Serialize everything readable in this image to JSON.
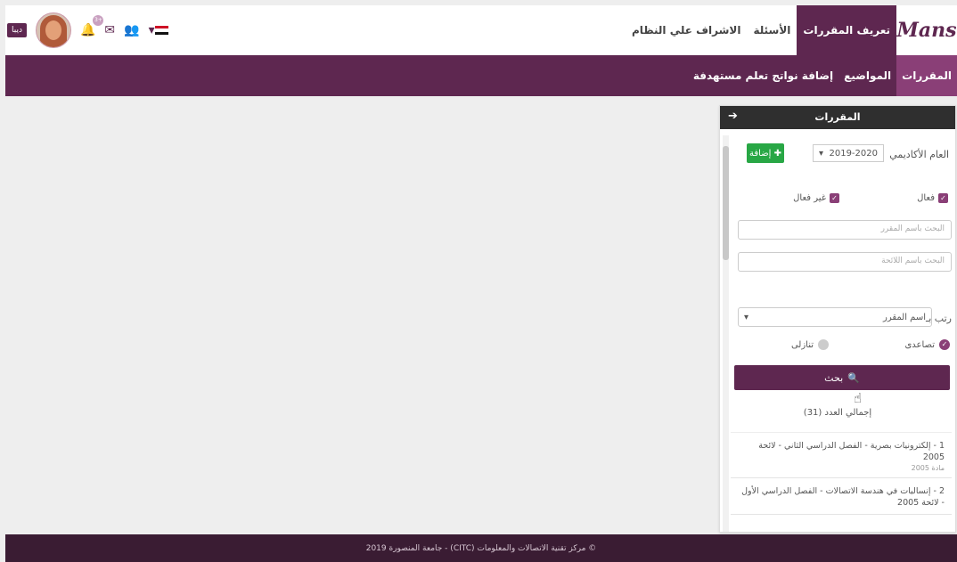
{
  "header": {
    "brand": "Mans",
    "nav": [
      {
        "label": "تعريف المقررات",
        "active": true
      },
      {
        "label": "الأسئلة",
        "active": false
      },
      {
        "label": "الاشراف علي النظام",
        "active": false
      }
    ],
    "lang_button": "ديبا",
    "notification_count": "3+",
    "icons": [
      "flag-egypt-icon",
      "users-icon",
      "envelope-icon",
      "bell-icon"
    ]
  },
  "subnav": [
    {
      "label": "المقررات",
      "active": true
    },
    {
      "label": "المواضيع",
      "active": false
    },
    {
      "label": "إضافة نواتج تعلم مستهدفة",
      "active": false
    }
  ],
  "panel": {
    "title": "المقررات",
    "year_label": "العام الأكاديمي",
    "year_value": "2019-2020",
    "add_button": "إضافة",
    "active_label": "فعال",
    "inactive_label": "غير فعال",
    "search_course_placeholder": "البحث باسم المقرر",
    "search_regulation_placeholder": "البحث باسم اللائحة",
    "sort_label": "رتب بـ",
    "sort_value": "اسم المقرر",
    "ascending_label": "تصاعدى",
    "descending_label": "تنازلى",
    "search_button": "بحث",
    "total_label": "إجمالي العدد (31)",
    "courses": [
      {
        "title": "1 - إلكترونيات بصرية - الفصل الدراسي الثاني - لائحة 2005",
        "sub": "مادة 2005"
      },
      {
        "title": "2 - إنساليات في هندسة الاتصالات - الفصل الدراسي الأول - لائحة 2005",
        "sub": ""
      }
    ]
  },
  "footer": "© مركز تقنية الاتصالات والمعلومات (CITC) - جامعة المنصورة 2019",
  "colors": {
    "primary": "#5e2750",
    "accent": "#8a3f77",
    "success": "#28a745",
    "footer": "#3a1c33"
  }
}
